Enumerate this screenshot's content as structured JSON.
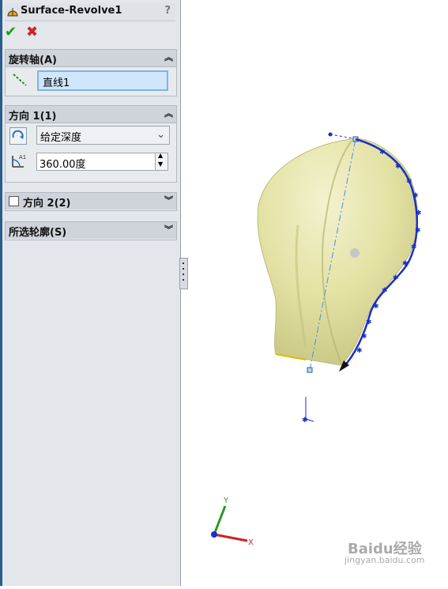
{
  "feature": {
    "title": "Surface-Revolve1",
    "help": "?"
  },
  "actions": {
    "ok_icon": "checkmark-icon",
    "cancel_icon": "x-icon"
  },
  "axis_group": {
    "header": "旋转轴(A)",
    "axis_value": "直线1"
  },
  "direction1": {
    "header": "方向 1(1)",
    "end_condition": "给定深度",
    "angle": "360.00度"
  },
  "direction2": {
    "header": "方向 2(2)",
    "checked": false
  },
  "contours": {
    "header": "所选轮廓(S)"
  },
  "triad": {
    "x": "X",
    "y": "Y"
  },
  "watermark": {
    "brand": "Baidu经验",
    "url": "jingyan.baidu.com"
  },
  "colors": {
    "accent": "#2a5c8c",
    "surface": "#e6e6a8",
    "sketch": "#1a2fc9"
  }
}
